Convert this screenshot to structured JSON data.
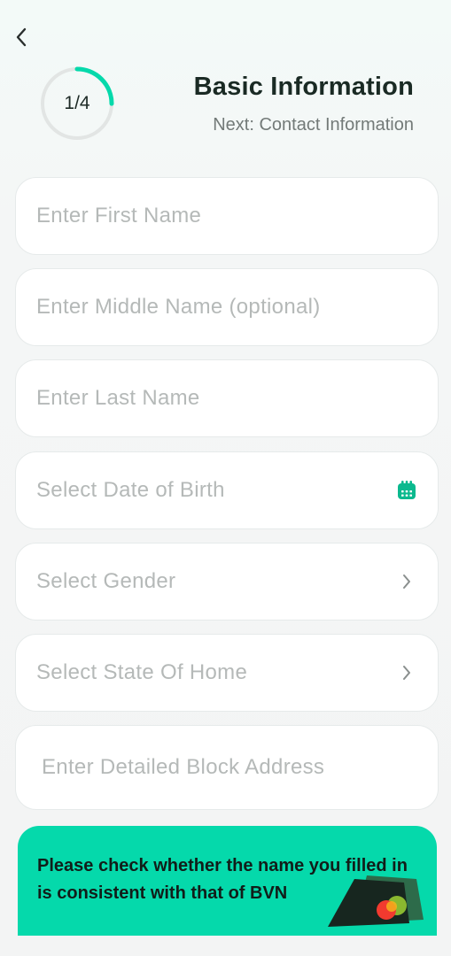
{
  "header": {
    "progress_label": "1/4",
    "progress_fraction": 0.25,
    "title": "Basic Information",
    "subtitle": "Next: Contact Information"
  },
  "form": {
    "first_name_placeholder": "Enter First Name",
    "middle_name_placeholder": "Enter Middle Name (optional)",
    "last_name_placeholder": "Enter Last Name",
    "dob_placeholder": "Select Date of Birth",
    "gender_placeholder": "Select Gender",
    "state_placeholder": "Select State Of Home",
    "address_placeholder": "Enter Detailed Block Address"
  },
  "banner": {
    "text": "Please check whether the name you filled in is consistent with that of BVN"
  },
  "colors": {
    "accent": "#05d9ab",
    "icon_accent": "#0bb98e",
    "ring_track": "#e2e5e4"
  },
  "icons": {
    "back": "chevron-left-icon",
    "dob": "calendar-icon",
    "select": "chevron-right-icon",
    "banner": "cards-icon"
  }
}
